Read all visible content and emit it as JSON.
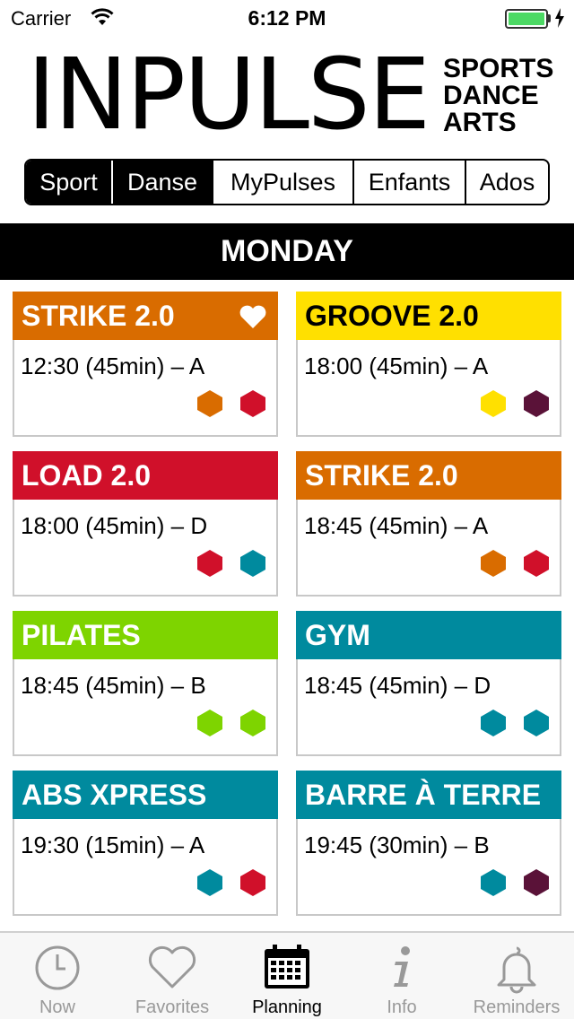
{
  "status_bar": {
    "carrier": "Carrier",
    "time": "6:12 PM",
    "battery_color": "#4cd964"
  },
  "logo": {
    "main": "INPULSE",
    "line1": "SPORTS",
    "line2": "DANCE",
    "line3": "ARTS"
  },
  "segments": [
    {
      "label": "Sport",
      "active": true
    },
    {
      "label": "Danse",
      "active": true
    },
    {
      "label": "MyPulses",
      "active": false
    },
    {
      "label": "Enfants",
      "active": false
    },
    {
      "label": "Ados",
      "active": false
    }
  ],
  "day": "MONDAY",
  "classes": [
    {
      "title": "STRIKE 2.0",
      "time": "12:30 (45min) – A",
      "color": "#d96c00",
      "favorite": true,
      "tags": [
        "#d96c00",
        "#d0102a"
      ]
    },
    {
      "title": "GROOVE 2.0",
      "time": "18:00 (45min) – A",
      "color": "#ffe000",
      "favorite": false,
      "tags": [
        "#ffe000",
        "#5a1238"
      ]
    },
    {
      "title": "LOAD 2.0",
      "time": "18:00 (45min) – D",
      "color": "#d0102a",
      "favorite": false,
      "tags": [
        "#d0102a",
        "#008a9e"
      ]
    },
    {
      "title": "STRIKE 2.0",
      "time": "18:45 (45min) – A",
      "color": "#d96c00",
      "favorite": false,
      "tags": [
        "#d96c00",
        "#d0102a"
      ]
    },
    {
      "title": "PILATES",
      "time": "18:45 (45min) – B",
      "color": "#7ed400",
      "favorite": false,
      "tags": [
        "#7ed400",
        "#7ed400"
      ]
    },
    {
      "title": "GYM",
      "time": "18:45 (45min) – D",
      "color": "#008a9e",
      "favorite": false,
      "tags": [
        "#008a9e",
        "#008a9e"
      ]
    },
    {
      "title": "ABS XPRESS",
      "time": "19:30 (15min) – A",
      "color": "#008a9e",
      "favorite": false,
      "tags": [
        "#008a9e",
        "#d0102a"
      ]
    },
    {
      "title": "BARRE À TERRE",
      "time": "19:45 (30min) – B",
      "color": "#008a9e",
      "favorite": false,
      "tags": [
        "#008a9e",
        "#5a1238"
      ]
    }
  ],
  "tabs": [
    {
      "label": "Now",
      "icon": "clock-icon",
      "active": false
    },
    {
      "label": "Favorites",
      "icon": "heart-icon",
      "active": false
    },
    {
      "label": "Planning",
      "icon": "calendar-icon",
      "active": true
    },
    {
      "label": "Info",
      "icon": "info-icon",
      "active": false
    },
    {
      "label": "Reminders",
      "icon": "bell-icon",
      "active": false
    }
  ]
}
